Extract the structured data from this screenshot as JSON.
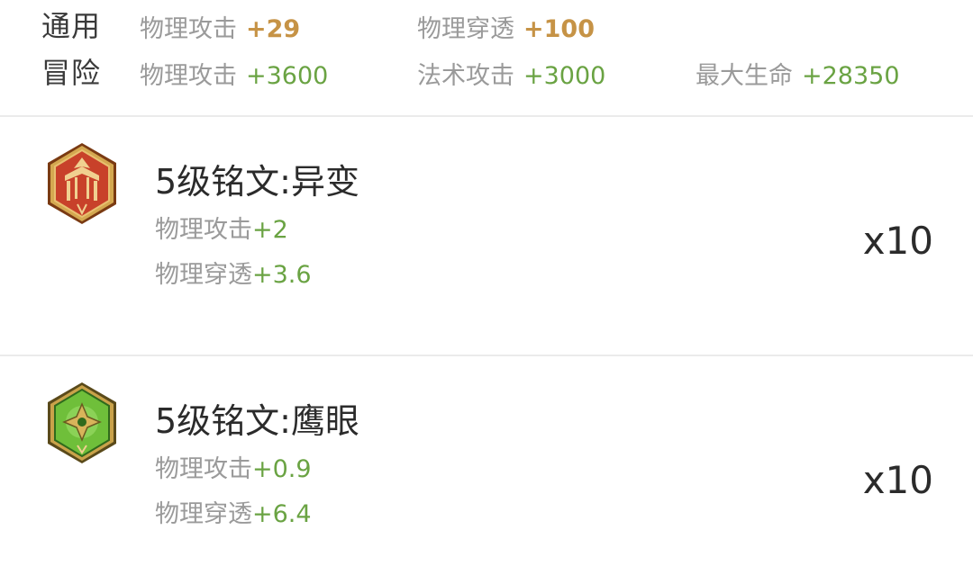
{
  "summary": {
    "general": {
      "title": "通用",
      "stats": [
        {
          "label": "物理攻击",
          "value": "+29"
        },
        {
          "label": "物理穿透",
          "value": "+100"
        }
      ]
    },
    "adventure": {
      "title": "冒险",
      "stats": [
        {
          "label": "物理攻击",
          "value": "+3600"
        },
        {
          "label": "法术攻击",
          "value": "+3000"
        },
        {
          "label": "最大生命",
          "value": "+28350"
        }
      ]
    }
  },
  "inscriptions": [
    {
      "name": "5级铭文:异变",
      "icon": "red-inscription-gem-icon",
      "count": "x10",
      "stats": [
        {
          "label": "物理攻击",
          "value": "+2"
        },
        {
          "label": "物理穿透",
          "value": "+3.6"
        }
      ]
    },
    {
      "name": "5级铭文:鹰眼",
      "icon": "green-inscription-gem-icon",
      "count": "x10",
      "stats": [
        {
          "label": "物理攻击",
          "value": "+0.9"
        },
        {
          "label": "物理穿透",
          "value": "+6.4"
        }
      ]
    }
  ],
  "colors": {
    "gold_value": "#c69346",
    "green_value": "#6aa343",
    "label_gray": "#9a9a9a",
    "title_dark": "#2b2b2b",
    "gem_red": "#c8412a",
    "gem_green": "#6fbf3a",
    "gem_frame": "#c9a24a"
  }
}
